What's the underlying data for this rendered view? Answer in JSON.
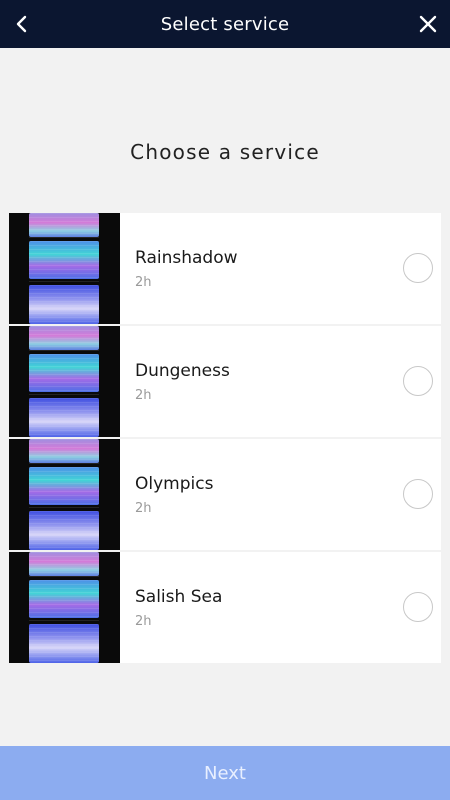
{
  "header": {
    "title": "Select service",
    "back_icon": "chevron-left-icon",
    "close_icon": "close-icon"
  },
  "main": {
    "heading": "Choose a service",
    "services": [
      {
        "name": "Rainshadow",
        "duration": "2h",
        "selected": false
      },
      {
        "name": "Dungeness",
        "duration": "2h",
        "selected": false
      },
      {
        "name": "Olympics",
        "duration": "2h",
        "selected": false
      },
      {
        "name": "Salish Sea",
        "duration": "2h",
        "selected": false
      }
    ]
  },
  "footer": {
    "next_label": "Next"
  },
  "colors": {
    "header_bg": "#0b1630",
    "page_bg": "#f2f2f2",
    "next_button_bg": "#8cacf0"
  }
}
